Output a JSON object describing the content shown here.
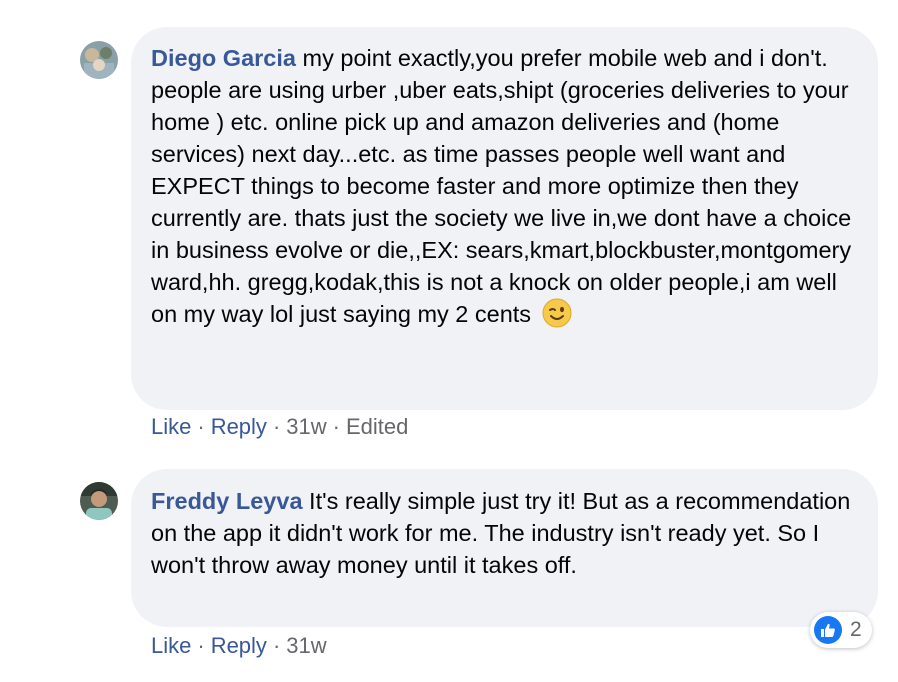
{
  "comments": [
    {
      "author": "Diego Garcia",
      "text": "my point exactly,you prefer mobile web and i don't. people are using urber ,uber eats,shipt (groceries deliveries to your home ) etc. online pick up and amazon deliveries and (home services) next day...etc. as time passes people well want and EXPECT things to become faster and more optimize then they currently are. thats just the society we live in,we dont have a choice in business evolve or die,,EX: sears,kmart,blockbuster,montgomery ward,hh. gregg,kodak,this is not a knock on older people,i am well on my way lol just saying my 2 cents",
      "emoji": "wink-emoji",
      "actions": {
        "like": "Like",
        "reply": "Reply",
        "time": "31w",
        "edited": "Edited"
      }
    },
    {
      "author": "Freddy Leyva",
      "text": "It's really simple just try it! But as a recommendation on the app it didn't work for me. The industry isn't ready yet. So I won't throw away money until it takes off.",
      "actions": {
        "like": "Like",
        "reply": "Reply",
        "time": "31w"
      },
      "reactions": {
        "icon": "thumbs-up-icon",
        "count": "2"
      }
    }
  ],
  "separator": "·",
  "colors": {
    "bubble": "#f0f2f5",
    "author": "#385898",
    "meta": "#65676b",
    "like_badge": "#1877f2"
  }
}
